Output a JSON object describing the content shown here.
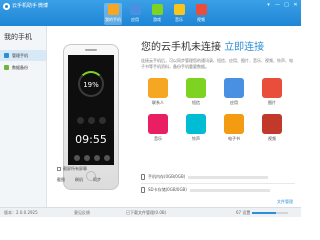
{
  "title_bar": {
    "app_name": "云手机助手",
    "link": "微博",
    "window_controls": [
      "▾",
      "—",
      "□",
      "✕"
    ],
    "nav": [
      {
        "label": "我的手机",
        "icon": "phone-icon",
        "color": "#f5a623",
        "active": true
      },
      {
        "label": "应用",
        "icon": "apps-icon",
        "color": "#4a90e2",
        "active": false
      },
      {
        "label": "游戏",
        "icon": "game-icon",
        "color": "#7ed321",
        "active": false
      },
      {
        "label": "音乐",
        "icon": "music-icon",
        "color": "#f8c51c",
        "active": false
      },
      {
        "label": "视频",
        "icon": "video-icon",
        "color": "#e94e3c",
        "active": false
      }
    ]
  },
  "sidebar": {
    "title": "我的手机",
    "items": [
      {
        "label": "管理手机",
        "icon": "phone-manage-icon",
        "active": true
      },
      {
        "label": "数据备份",
        "icon": "backup-icon",
        "active": false
      }
    ]
  },
  "phone": {
    "battery_percent": "19%",
    "battery_fraction": 0.19,
    "clock": "09:55",
    "checkbox_label": "截屏所有屏幕",
    "actions": [
      "截图",
      "刷机",
      "同步"
    ]
  },
  "main": {
    "headline_prefix": "您的云手机未连接",
    "headline_link": "立即连接",
    "description": "连接云手机后，可以同步管理您的通讯录、短信、应用、图片、音乐、视频、铃声、电子书等手机资料，备份手机重要数据。",
    "tiles": [
      {
        "label": "联系人",
        "icon": "contacts-icon",
        "color": "#f5a623"
      },
      {
        "label": "短信",
        "icon": "sms-icon",
        "color": "#7ed321"
      },
      {
        "label": "应用",
        "icon": "apps-icon",
        "color": "#4a90e2"
      },
      {
        "label": "图片",
        "icon": "picture-icon",
        "color": "#e94e3c"
      },
      {
        "label": "音乐",
        "icon": "music-icon",
        "color": "#e91e63"
      },
      {
        "label": "铃声",
        "icon": "ringtone-icon",
        "color": "#00bcd4"
      },
      {
        "label": "电子书",
        "icon": "ebook-icon",
        "color": "#f39c12"
      },
      {
        "label": "视频",
        "icon": "video-icon",
        "color": "#c0392b"
      }
    ],
    "storage": [
      {
        "label": "手机内存(0GB/0GB)",
        "fill": 0.0
      },
      {
        "label": "SD卡存储(0GB/0GB)",
        "fill": 0.0
      }
    ],
    "file_link": "文件管理"
  },
  "status_bar": {
    "version": "版本：2.0.0.2925",
    "feedback": "意见反馈",
    "download": "已下载文件管理(0.0B)",
    "progress_label": "67 设置",
    "progress_fraction": 0.67
  }
}
